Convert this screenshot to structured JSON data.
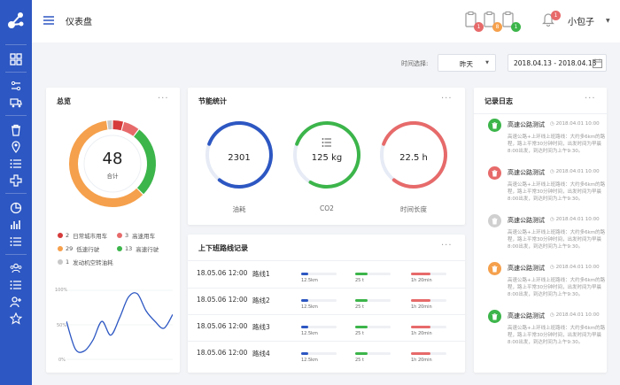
{
  "header": {
    "title": "仪表盘",
    "user_name": "小包子",
    "notifications": [
      {
        "icon": "clipboard-icon",
        "count": "1",
        "color": "#e76a6a"
      },
      {
        "icon": "clipboard-icon",
        "count": "8",
        "color": "#f5a04c"
      },
      {
        "icon": "clipboard-icon",
        "count": "1",
        "color": "#3cb54a"
      },
      {
        "icon": "bell-icon",
        "count": "1",
        "color": "#e76a6a"
      }
    ]
  },
  "filters": {
    "time_label": "时间选择:",
    "period": "昨天",
    "date_range": "2018.04.13  -  2018.04.13"
  },
  "overview": {
    "title": "总览",
    "more": "···",
    "total": "48",
    "total_label": "合计",
    "legend": [
      {
        "count": "2",
        "label": "日常城市用车",
        "color": "#d63a3a"
      },
      {
        "count": "3",
        "label": "高速用车",
        "color": "#e76a6a"
      },
      {
        "count": "29",
        "label": "低速行驶",
        "color": "#f5a04c"
      },
      {
        "count": "13",
        "label": "高速行驶",
        "color": "#3cb54a"
      },
      {
        "count": "1",
        "label": "发动机空转油耗",
        "color": "#c8c8c8"
      }
    ],
    "line_chart": {
      "y_ticks": [
        "100%",
        "50%",
        "0%"
      ]
    }
  },
  "energy": {
    "title": "节能统计",
    "more": "···",
    "gauges": [
      {
        "value": "2301",
        "label": "油耗",
        "color": "#2d57c2",
        "fraction": 0.8
      },
      {
        "value": "125 kg",
        "label": "CO2",
        "color": "#3cb54a",
        "fraction": 0.78
      },
      {
        "value": "22.5 h",
        "label": "时间长度",
        "color": "#e76a6a",
        "fraction": 0.8
      }
    ]
  },
  "commute": {
    "title": "上下班路线记录",
    "more": "···",
    "rows": [
      {
        "time": "18.05.06 12:00",
        "route": "路线1",
        "distance": "12.5km",
        "load": "25 t",
        "duration": "1h 20min"
      },
      {
        "time": "18.05.06 12:00",
        "route": "路线2",
        "distance": "12.5km",
        "load": "25 t",
        "duration": "1h 20min"
      },
      {
        "time": "18.05.06 12:00",
        "route": "路线3",
        "distance": "12.5km",
        "load": "25 t",
        "duration": "1h 20min"
      },
      {
        "time": "18.05.06 12:00",
        "route": "路线4",
        "distance": "12.5km",
        "load": "25 t",
        "duration": "1h 20min"
      }
    ],
    "bar_colors": [
      "#2d57c2",
      "#3cb54a",
      "#e76a6a"
    ],
    "bar_fractions": [
      0.2,
      0.35,
      0.55
    ]
  },
  "log": {
    "title": "记录日志",
    "more": "···",
    "items": [
      {
        "title": "高速公路测试",
        "time": "2018.04.01 10:00",
        "body": "高速公路+上环线上班路线：大约多6km的路程，路上平常30分钟时间，出发时间为早晨8:00出发，到达时间为上午9:30。",
        "color": "#3cb54a"
      },
      {
        "title": "高速公路测试",
        "time": "2018.04.01 10:00",
        "body": "高速公路+上环线上班路线：大约多6km的路程，路上平常30分钟时间，出发时间为早晨8:00出发，到达时间为上午9:30。",
        "color": "#e76a6a"
      },
      {
        "title": "高速公路测试",
        "time": "2018.04.01 10:00",
        "body": "高速公路+上环线上班路线：大约多6km的路程，路上平常30分钟时间，出发时间为早晨8:00出发，到达时间为上午9:30。",
        "color": "#d0d0d0"
      },
      {
        "title": "高速公路测试",
        "time": "2018.04.01 10:00",
        "body": "高速公路+上环线上班路线：大约多6km的路程，路上平常30分钟时间，出发时间为早晨8:00出发，到达时间为上午9:30。",
        "color": "#f5a04c"
      },
      {
        "title": "高速公路测试",
        "time": "2018.04.01 10:00",
        "body": "高速公路+上环线上班路线：大约多6km的路程，路上平常30分钟时间，出发时间为早晨8:00出发，到达时间为上午9:30。",
        "color": "#3cb54a"
      }
    ]
  },
  "chart_data": [
    {
      "type": "pie",
      "title": "",
      "categories": [
        "日常城市用车",
        "高速用车",
        "低速行驶",
        "高速行驶",
        "发动机空转油耗"
      ],
      "values": [
        2,
        3,
        29,
        13,
        1
      ],
      "total": 48
    },
    {
      "type": "line",
      "title": "",
      "x": [
        0,
        1,
        2,
        3,
        4,
        5,
        6,
        7,
        8,
        9,
        10,
        11,
        12
      ],
      "values": [
        55,
        15,
        12,
        28,
        55,
        35,
        60,
        90,
        95,
        70,
        55,
        45,
        65
      ],
      "ylim": [
        0,
        100
      ],
      "ylabel": ""
    }
  ]
}
